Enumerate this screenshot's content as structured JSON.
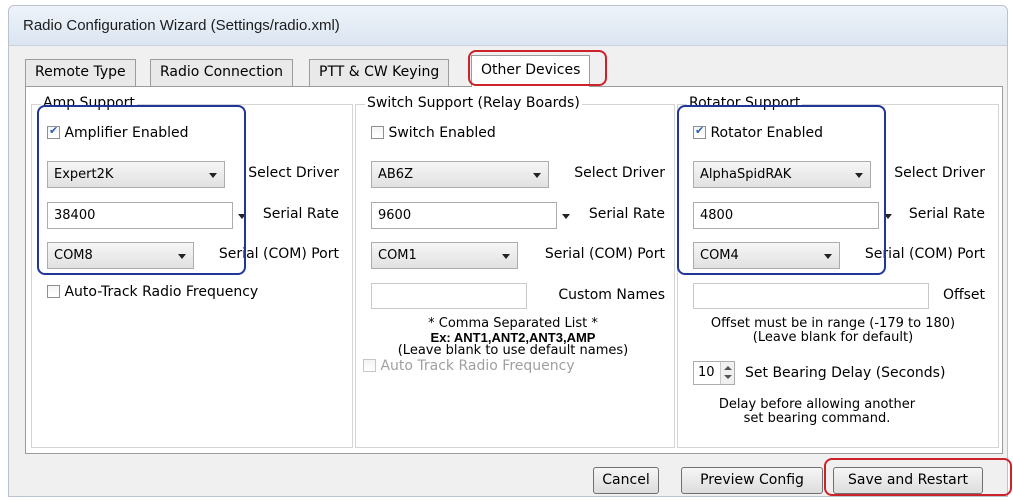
{
  "window": {
    "title": "Radio Configuration Wizard (Settings/radio.xml)"
  },
  "tabs": [
    {
      "label": "Remote Type",
      "active": false
    },
    {
      "label": "Radio Connection",
      "active": false
    },
    {
      "label": "PTT & CW Keying",
      "active": false
    },
    {
      "label": "Other Devices",
      "active": true
    }
  ],
  "amp": {
    "legend": "Amp Support",
    "enabled_label": "Amplifier Enabled",
    "enabled": true,
    "driver_value": "Expert2K",
    "driver_label": "Select Driver",
    "rate_value": "38400",
    "rate_label": "Serial Rate",
    "port_value": "COM8",
    "port_label": "Serial (COM) Port",
    "autotrack_label": "Auto-Track Radio Frequency",
    "autotrack": false
  },
  "switch": {
    "legend": "Switch Support (Relay Boards)",
    "enabled_label": "Switch Enabled",
    "enabled": false,
    "driver_value": "AB6Z",
    "driver_label": "Select Driver",
    "rate_value": "9600",
    "rate_label": "Serial Rate",
    "port_value": "COM1",
    "port_label": "Serial (COM) Port",
    "custom_names_value": "",
    "custom_names_label": "Custom Names",
    "note_line1": "* Comma Separated List *",
    "note_line2": "Ex: ANT1,ANT2,ANT3,AMP",
    "note_line3": "(Leave blank to use default names)",
    "autotrack_label": "Auto Track Radio Frequency",
    "autotrack": false
  },
  "rotator": {
    "legend": "Rotator Support",
    "enabled_label": "Rotator Enabled",
    "enabled": true,
    "driver_value": "AlphaSpidRAK",
    "driver_label": "Select Driver",
    "rate_value": "4800",
    "rate_label": "Serial Rate",
    "port_value": "COM4",
    "port_label": "Serial (COM) Port",
    "offset_value": "",
    "offset_label": "Offset",
    "offset_note_line1": "Offset must be in range (-179 to 180)",
    "offset_note_line2": "(Leave blank for default)",
    "bearing_delay_value": "10",
    "bearing_delay_label": "Set Bearing Delay (Seconds)",
    "delay_note_line1": "Delay before allowing another",
    "delay_note_line2": "set bearing command."
  },
  "buttons": {
    "cancel": "Cancel",
    "preview": "Preview Config",
    "save": "Save and Restart"
  },
  "colors": {
    "highlight_red": "#cc2229",
    "highlight_blue": "#21369a",
    "check_blue": "#2a5eb0"
  }
}
